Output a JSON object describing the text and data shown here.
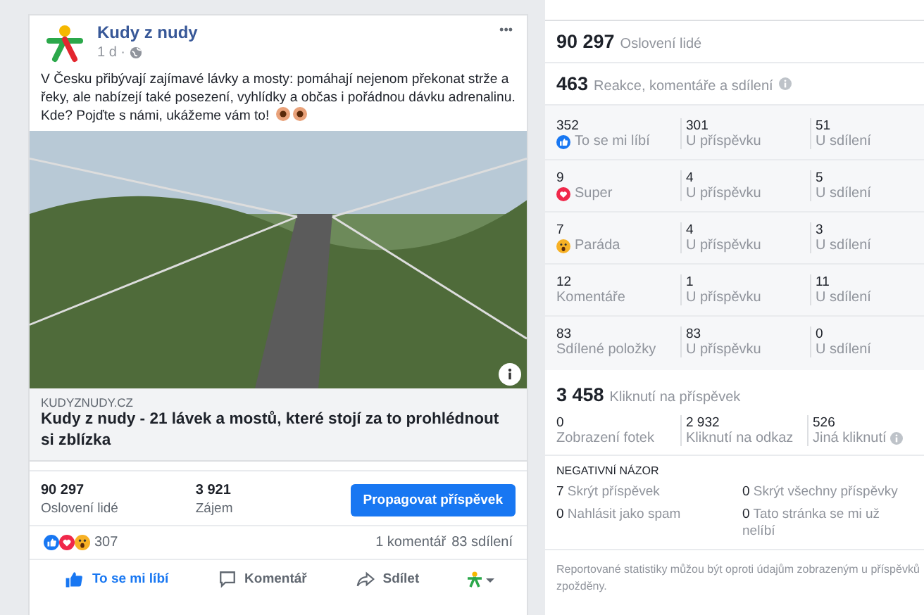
{
  "post": {
    "page_name": "Kudy z nudy",
    "time": "1 d ·",
    "menu": "•••",
    "text": "V Česku přibývají zajímavé lávky a mosty: pomáhají nejenom překonat strže a řeky, ale nabízejí také posezení, vyhlídky a občas i pořádnou dávku adrenalinu. Kde? Pojďte s námi, ukážeme vám to!",
    "link_domain": "KUDYZNUDY.CZ",
    "link_title": "Kudy z nudy - 21 lávek a mostů, které stojí za to prohlédnout si zblízka",
    "stats": [
      {
        "value": "90 297",
        "label": "Oslovení lidé"
      },
      {
        "value": "3 921",
        "label": "Zájem"
      }
    ],
    "promote_button": "Propagovat příspěvek",
    "reaction_count": "307",
    "comments": "1 komentář",
    "shares": "83 sdílení",
    "actions": [
      {
        "kind": "like",
        "label": "To se mi líbí"
      },
      {
        "kind": "comment",
        "label": "Komentář"
      },
      {
        "kind": "share",
        "label": "Sdílet"
      }
    ]
  },
  "insights": {
    "reach": {
      "value": "90 297",
      "label": "Oslovení lidé"
    },
    "engagement": {
      "value": "463",
      "label": "Reakce, komentáře a sdílení"
    },
    "rows": [
      {
        "kind": "like",
        "value": "352",
        "label": "To se mi líbí",
        "post_value": "301",
        "post_label": "U příspěvku",
        "share_value": "51",
        "share_label": "U sdílení"
      },
      {
        "kind": "love",
        "value": "9",
        "label": "Super",
        "post_value": "4",
        "post_label": "U příspěvku",
        "share_value": "5",
        "share_label": "U sdílení"
      },
      {
        "kind": "wow",
        "value": "7",
        "label": "Paráda",
        "post_value": "4",
        "post_label": "U příspěvku",
        "share_value": "3",
        "share_label": "U sdílení"
      },
      {
        "kind": "none",
        "value": "12",
        "label": "Komentáře",
        "post_value": "1",
        "post_label": "U příspěvku",
        "share_value": "11",
        "share_label": "U sdílení"
      },
      {
        "kind": "none",
        "value": "83",
        "label": "Sdílené položky",
        "post_value": "83",
        "post_label": "U příspěvku",
        "share_value": "0",
        "share_label": "U sdílení"
      }
    ],
    "clicks": {
      "value": "3 458",
      "label": "Kliknutí na příspěvek"
    },
    "click_breakdown": [
      {
        "value": "0",
        "label": "Zobrazení fotek",
        "info": false
      },
      {
        "value": "2 932",
        "label": "Kliknutí na odkaz",
        "info": false
      },
      {
        "value": "526",
        "label": "Jiná kliknutí",
        "info": true
      }
    ],
    "negative_title": "NEGATIVNÍ NÁZOR",
    "negative": [
      "**7** Skrýt příspěvek",
      "**0** Skrýt všechny příspěvky",
      "**0** Nahlásit jako spam",
      "**0** Tato stránka se mi už nelíbí"
    ],
    "footnote": "Reportované statistiky můžou být oproti údajům zobrazeným u příspěvků zpožděny."
  }
}
